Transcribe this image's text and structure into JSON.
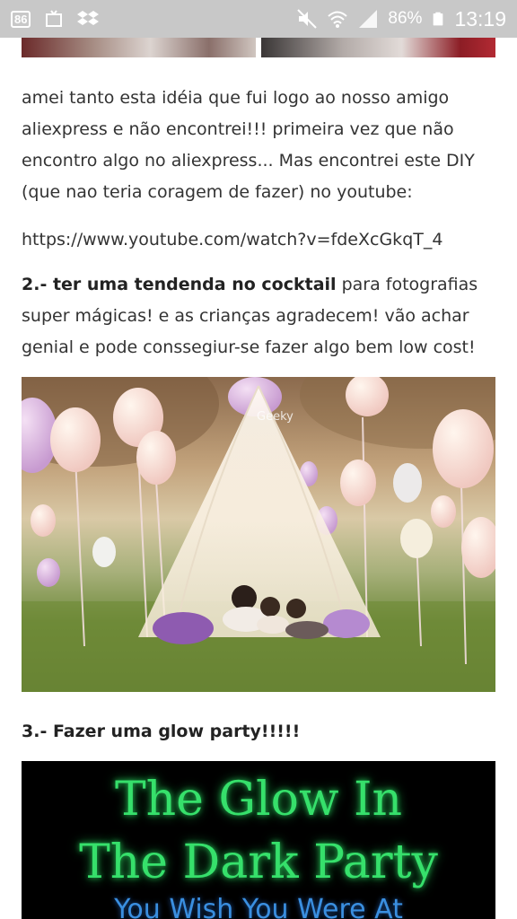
{
  "status_bar": {
    "notification_badge": "86",
    "battery_percent": "86%",
    "time": "13:19",
    "icons": [
      "screen-icon",
      "cast-icon",
      "dropbox-icon",
      "mute-icon",
      "wifi-icon",
      "signal-icon",
      "battery-icon"
    ]
  },
  "article": {
    "paragraph_1": "amei tanto esta idéia que fui logo ao nosso amigo aliexpress e não encontrei!!! primeira vez que não encontro algo no aliexpress... Mas encontrei este DIY (que nao teria coragem de fazer) no youtube:",
    "link": "https://www.youtube.com/watch?v=fdeXcGkqT_4",
    "item_2_bold": "2.- ter uma tendenda no cocktail",
    "item_2_rest": " para fotografias super mágicas! e as crianças agradecem! vão achar genial e pode conssegiur-se fazer algo bem low cost!",
    "photo_watermark": "Geeky",
    "item_3_bold": "3.- Fazer uma glow party!!!!!",
    "glow_image": {
      "line1": "The Glow In",
      "line2": "The Dark Party",
      "line3": "You Wish You Were At"
    }
  }
}
